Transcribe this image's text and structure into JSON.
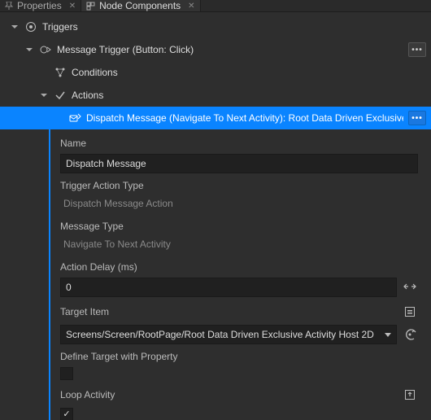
{
  "tabs": {
    "properties": "Properties",
    "node_components": "Node Components"
  },
  "tree": {
    "triggers": "Triggers",
    "message_trigger": "Message Trigger (Button: Click)",
    "conditions": "Conditions",
    "actions": "Actions",
    "dispatch": "Dispatch Message (Navigate To Next Activity): Root Data Driven Exclusive A"
  },
  "details": {
    "name_label": "Name",
    "name_value": "Dispatch Message",
    "trigger_action_type_label": "Trigger Action Type",
    "trigger_action_type_value": "Dispatch Message Action",
    "message_type_label": "Message Type",
    "message_type_value": "Navigate To Next Activity",
    "action_delay_label": "Action Delay (ms)",
    "action_delay_value": "0",
    "target_item_label": "Target Item",
    "target_item_value": "Screens/Screen/RootPage/Root Data Driven Exclusive Activity Host 2D",
    "define_target_label": "Define Target with Property",
    "define_target_checked": false,
    "loop_activity_label": "Loop Activity",
    "loop_activity_checked": true
  }
}
